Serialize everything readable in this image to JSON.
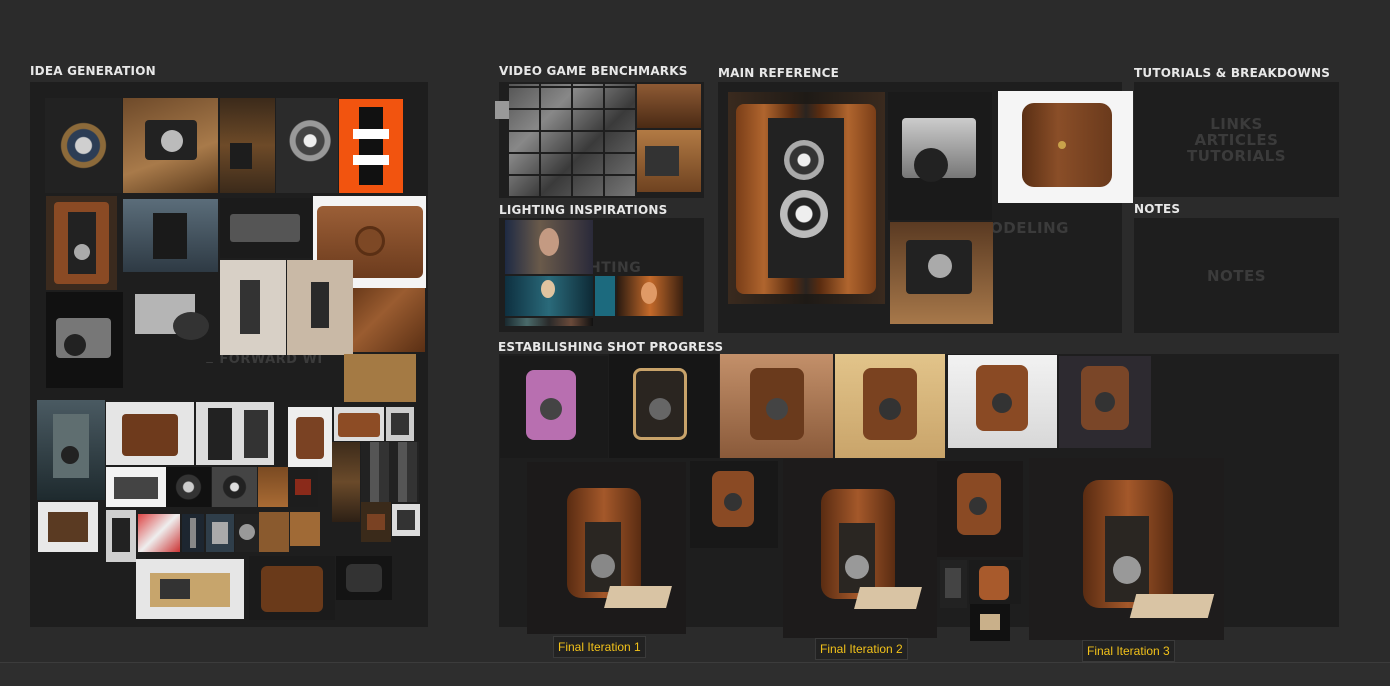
{
  "sections": {
    "idea": {
      "title": "IDEA GENERATION",
      "ghost": "E FORWARD WI"
    },
    "benchmarks": {
      "title": "VIDEO GAME BENCHMARKS"
    },
    "lighting": {
      "title": "LIGHTING INSPIRATIONS",
      "ghost": "HTING"
    },
    "main_ref": {
      "title": "MAIN REFERENCE",
      "ghost": "ODELING"
    },
    "tutorials": {
      "title": "TUTORIALS & BREAKDOWNS",
      "ghost_lines": [
        "LINKS",
        "ARTICLES",
        "TUTORIALS"
      ]
    },
    "notes": {
      "title": "NOTES",
      "ghost": "NOTES"
    },
    "progress": {
      "title": "ESTABILISHING SHOT PROGRESS"
    }
  },
  "captions": {
    "final1": "Final Iteration 1",
    "final2": "Final Iteration 2",
    "final3": "Final Iteration 3"
  },
  "colors": {
    "background": "#2b2b2b",
    "panel": "#1e1e1e",
    "caption_text": "#f2c21a",
    "leather_brown": "#8a4a24",
    "accent_orange": "#f2540f"
  },
  "icons": {
    "camera": "camera-icon",
    "bag": "leather-case-icon"
  }
}
